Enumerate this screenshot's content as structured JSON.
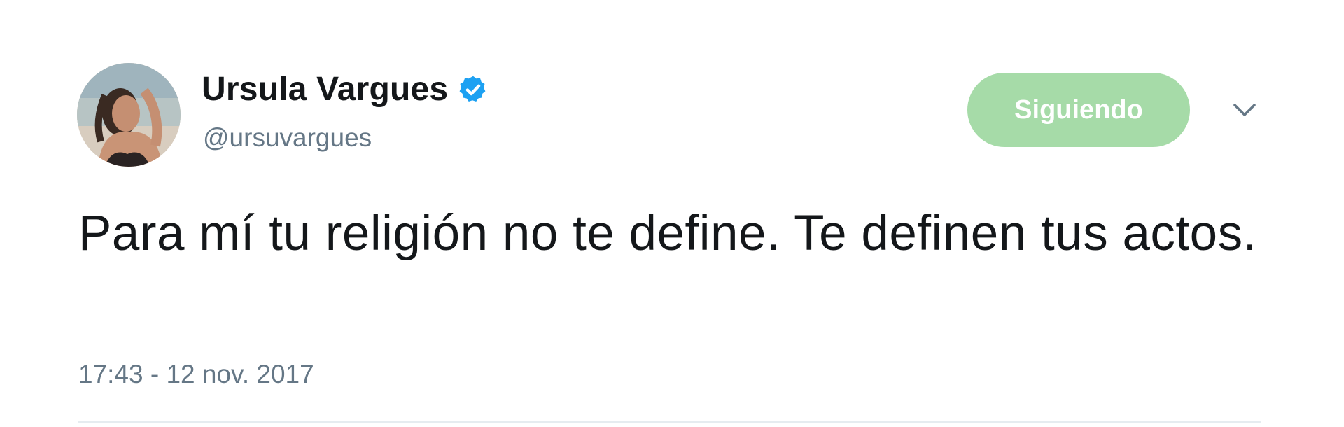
{
  "user": {
    "display_name": "Ursula Vargues",
    "handle": "@ursuvargues",
    "verified": true
  },
  "follow_button": {
    "label": "Siguiendo",
    "color": "#a6dba8"
  },
  "menu": {
    "icon": "chevron-down-icon"
  },
  "tweet": {
    "text": "Para mí tu religión no te define. Te definen tus actos.",
    "timestamp": "17:43 - 12 nov. 2017"
  },
  "colors": {
    "text": "#14171a",
    "secondary": "#657786",
    "verified": "#1da1f2"
  }
}
